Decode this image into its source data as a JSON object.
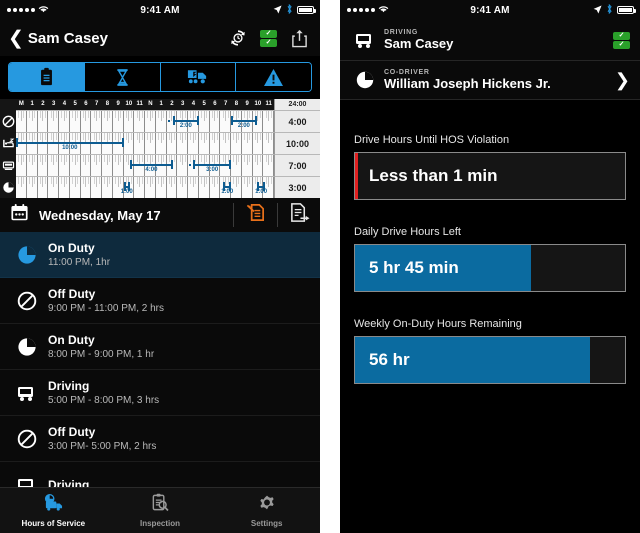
{
  "status_bar": {
    "signal_dots": 5,
    "wifi_icon": "wifi-icon",
    "time": "9:41 AM",
    "location_icon": "location-arrow-icon",
    "bluetooth_icon": "bluetooth-icon",
    "battery_icon": "battery-full-icon"
  },
  "left": {
    "nav": {
      "back_icon": "chevron-left-icon",
      "title": "Sam Casey",
      "sync_icon": "sync-clock-icon",
      "certified_badge_icon": "double-green-check-icon",
      "share_icon": "share-export-icon"
    },
    "segments": [
      {
        "name": "logs",
        "icon": "clipboard-icon",
        "active": true
      },
      {
        "name": "hours",
        "icon": "hourglass-icon",
        "active": false
      },
      {
        "name": "vehicle",
        "icon": "truck-trailer-icon",
        "active": false
      },
      {
        "name": "violations",
        "icon": "warning-triangle-icon",
        "active": false
      }
    ],
    "grid": {
      "hour_labels": [
        "M",
        "1",
        "2",
        "3",
        "4",
        "5",
        "6",
        "7",
        "8",
        "9",
        "10",
        "11",
        "N",
        "1",
        "2",
        "3",
        "4",
        "5",
        "6",
        "7",
        "8",
        "9",
        "10",
        "11"
      ],
      "total_header": "24:00",
      "rows": [
        {
          "status": "off-duty",
          "icon": "off-duty-circle-slash-icon",
          "total": "4:00",
          "segments": [
            {
              "start_hour": 14.6,
              "end_hour": 17.0,
              "label": "2:00",
              "lead_dot": true
            },
            {
              "start_hour": 20.0,
              "end_hour": 22.4,
              "label": "2:00",
              "lead_dot": false
            }
          ]
        },
        {
          "status": "sleeper-berth",
          "icon": "sleeper-berth-bed-icon",
          "total": "10:00",
          "segments": [
            {
              "start_hour": 0.0,
              "end_hour": 10.0,
              "label": "10:00",
              "lead_dot": false
            }
          ]
        },
        {
          "status": "driving",
          "icon": "driving-truck-icon",
          "total": "7:00",
          "segments": [
            {
              "start_hour": 10.6,
              "end_hour": 14.6,
              "label": "4:00",
              "lead_dot": false
            },
            {
              "start_hour": 16.5,
              "end_hour": 20.0,
              "label": "3:00",
              "lead_dot": true
            }
          ]
        },
        {
          "status": "on-duty",
          "icon": "on-duty-clock-icon",
          "total": "3:00",
          "segments": [
            {
              "start_hour": 10.0,
              "end_hour": 10.6,
              "label": "1:00",
              "lead_dot": false
            },
            {
              "start_hour": 19.3,
              "end_hour": 20.0,
              "label": "1:00",
              "lead_dot": false
            },
            {
              "start_hour": 22.4,
              "end_hour": 23.2,
              "label": "1:00",
              "lead_dot": false
            }
          ]
        }
      ]
    },
    "date_bar": {
      "calendar_icon": "calendar-icon",
      "date": "Wednesday, May 17",
      "edit_icon": "edit-log-orange-icon",
      "transfer_icon": "transfer-document-icon"
    },
    "duty_events": [
      {
        "icon": "on-duty-clock-icon",
        "title": "On Duty",
        "detail": "11:00 PM, 1hr",
        "selected": true
      },
      {
        "icon": "off-duty-slash-icon",
        "title": "Off Duty",
        "detail": "9:00 PM - 11:00 PM, 2 hrs",
        "selected": false
      },
      {
        "icon": "on-duty-clock-icon",
        "title": "On Duty",
        "detail": "8:00 PM - 9:00 PM, 1 hr",
        "selected": false
      },
      {
        "icon": "driving-truck-icon",
        "title": "Driving",
        "detail": "5:00 PM - 8:00 PM, 3 hrs",
        "selected": false
      },
      {
        "icon": "off-duty-slash-icon",
        "title": "Off Duty",
        "detail": "3:00 PM- 5:00 PM, 2 hrs",
        "selected": false
      },
      {
        "icon": "driving-truck-icon",
        "title": "Driving",
        "detail": "",
        "selected": false
      }
    ],
    "tabs": [
      {
        "name": "hours-of-service",
        "label": "Hours of Service",
        "icon": "hos-clock-truck-icon",
        "active": true
      },
      {
        "name": "inspection",
        "label": "Inspection",
        "icon": "inspection-clipboard-magnifier-icon",
        "active": false
      },
      {
        "name": "settings",
        "label": "Settings",
        "icon": "gear-icon",
        "active": false
      }
    ]
  },
  "right": {
    "driver": {
      "kicker": "DRIVING",
      "name": "Sam Casey",
      "icon": "driving-truck-icon",
      "badge_icon": "double-green-check-icon"
    },
    "codriver": {
      "kicker": "CO-DRIVER",
      "name": "William Joseph Hickens Jr.",
      "icon": "on-duty-clock-icon",
      "chevron_icon": "chevron-right-icon"
    },
    "metrics": [
      {
        "name": "drive-hours-until-hos-violation",
        "label": "Drive Hours Until HOS Violation",
        "value": "Less than 1 min",
        "fill_percent": 0,
        "accent_color": "#e02020",
        "fill_color": "#0b6ba0",
        "has_accent_bar": true
      },
      {
        "name": "daily-drive-hours-left",
        "label": "Daily Drive Hours Left",
        "value": "5 hr 45 min",
        "fill_percent": 65,
        "accent_color": "",
        "fill_color": "#0b6ba0",
        "has_accent_bar": false
      },
      {
        "name": "weekly-on-duty-hours-remaining",
        "label": "Weekly On-Duty Hours Remaining",
        "value": "56 hr",
        "fill_percent": 87,
        "accent_color": "",
        "fill_color": "#0b6ba0",
        "has_accent_bar": false
      }
    ]
  }
}
